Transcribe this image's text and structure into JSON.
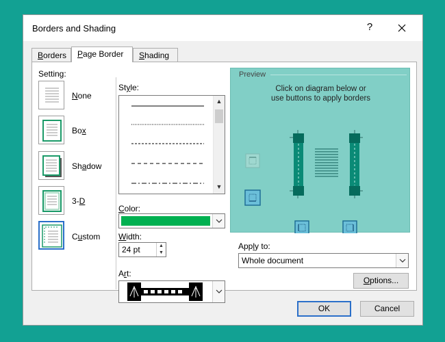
{
  "dialog": {
    "title": "Borders and Shading",
    "help_glyph": "?",
    "close_icon": "close-icon"
  },
  "tabs": [
    {
      "label": "Borders",
      "accel": "B",
      "rest": "orders",
      "active": false
    },
    {
      "label": "Page Border",
      "accel": "P",
      "rest": "age Border",
      "active": true
    },
    {
      "label": "Shading",
      "accel": "S",
      "rest": "hading",
      "active": false
    }
  ],
  "setting": {
    "label": "Setting:",
    "options": [
      {
        "label": "None",
        "accel": "N",
        "rest": "one",
        "icon": "border-none-icon",
        "selected": false
      },
      {
        "label": "Box",
        "accel": "x",
        "pre": "Bo",
        "icon": "border-box-icon",
        "selected": false
      },
      {
        "label": "Shadow",
        "accel": "a",
        "pre": "Sh",
        "rest": "dow",
        "icon": "border-shadow-icon",
        "selected": false
      },
      {
        "label": "3-D",
        "accel": "D",
        "pre": "3-",
        "icon": "border-3d-icon",
        "selected": false
      },
      {
        "label": "Custom",
        "accel": "u",
        "pre": "C",
        "rest": "stom",
        "icon": "border-custom-icon",
        "selected": true
      }
    ]
  },
  "style": {
    "label": "Style:",
    "accel": "y",
    "line_styles": [
      "solid",
      "dotted",
      "dashed-small",
      "dashed",
      "dash-dot"
    ]
  },
  "color": {
    "label": "Color:",
    "accel": "C",
    "value": "#00b050"
  },
  "width": {
    "label": "Width:",
    "accel": "W",
    "value": "24 pt"
  },
  "art": {
    "label": "Art:",
    "accel": "r"
  },
  "preview": {
    "title": "Preview",
    "instruction_line1": "Click on diagram below or",
    "instruction_line2": "use buttons to apply borders"
  },
  "apply_to": {
    "label": "Apply to:",
    "accel": "L",
    "value": "Whole document"
  },
  "buttons": {
    "options": "Options...",
    "options_accel": "O",
    "ok": "OK",
    "cancel": "Cancel"
  },
  "colors": {
    "background": "#12a193",
    "accent": "#2a6fc9",
    "preview_bg": "#81cfc6",
    "border_green": "#1a9a68"
  }
}
